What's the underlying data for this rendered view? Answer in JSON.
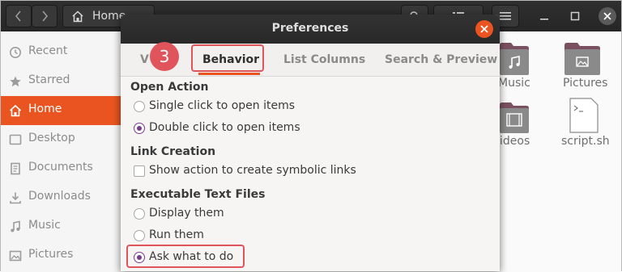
{
  "files_window": {
    "path_label": "Home",
    "sidebar": [
      {
        "label": "Recent",
        "icon": "clock-icon",
        "active": false
      },
      {
        "label": "Starred",
        "icon": "star-icon",
        "active": false
      },
      {
        "label": "Home",
        "icon": "home-icon",
        "active": true
      },
      {
        "label": "Desktop",
        "icon": "desktop-icon",
        "active": false
      },
      {
        "label": "Documents",
        "icon": "document-icon",
        "active": false
      },
      {
        "label": "Downloads",
        "icon": "download-icon",
        "active": false
      },
      {
        "label": "Music",
        "icon": "music-icon",
        "active": false
      },
      {
        "label": "Pictures",
        "icon": "picture-icon",
        "active": false
      }
    ],
    "items": [
      {
        "label": "Music",
        "icon": "music-folder-icon"
      },
      {
        "label": "Pictures",
        "icon": "pictures-folder-icon"
      },
      {
        "label": "ideos",
        "icon": "videos-folder-icon"
      },
      {
        "label": "script.sh",
        "icon": "script-file-icon"
      }
    ]
  },
  "dialog": {
    "title": "Preferences",
    "tabs": [
      {
        "label": "V",
        "active": false
      },
      {
        "label": "Behavior",
        "active": true
      },
      {
        "label": "List Columns",
        "active": false
      },
      {
        "label": "Search & Preview",
        "active": false
      }
    ],
    "step_badge": "3",
    "sections": {
      "open_action": {
        "heading": "Open Action",
        "options": [
          {
            "label": "Single click to open items",
            "selected": false
          },
          {
            "label": "Double click to open items",
            "selected": true
          }
        ]
      },
      "link_creation": {
        "heading": "Link Creation",
        "checkbox": {
          "label": "Show action to create symbolic links",
          "checked": false
        }
      },
      "executable": {
        "heading": "Executable Text Files",
        "options": [
          {
            "label": "Display them",
            "selected": false
          },
          {
            "label": "Run them",
            "selected": false
          },
          {
            "label": "Ask what to do",
            "selected": true
          }
        ]
      }
    }
  },
  "colors": {
    "accent": "#e95420",
    "highlight": "#e0545c",
    "radio": "#7a3c8f"
  }
}
